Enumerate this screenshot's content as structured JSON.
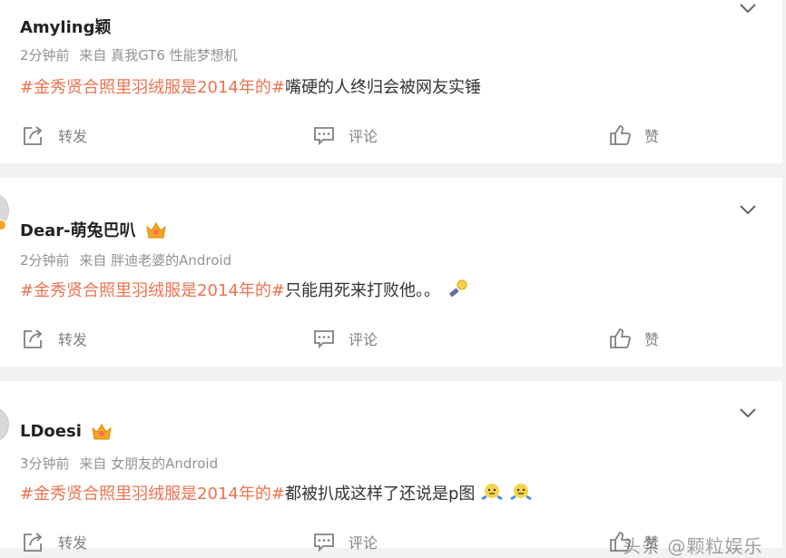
{
  "actions": {
    "repost": "转发",
    "comment": "评论",
    "like": "赞"
  },
  "posts": [
    {
      "name": "Amyling颖",
      "badge": "",
      "time": "2分钟前",
      "source": "来自 真我GT6 性能梦想机",
      "topic": "#金秀贤合照里羽绒服是2014年的#",
      "text": "嘴硬的人终归会被网友实锤",
      "emojis": []
    },
    {
      "name": "Dear-萌兔巴叭",
      "badge": "crown-icon",
      "time": "2分钟前",
      "source": "来自 胖迪老婆的Android",
      "topic": "#金秀贤合照里羽绒服是2014年的#",
      "text": "只能用死来打败他。。",
      "emojis": [
        "hammer-emoji"
      ]
    },
    {
      "name": "LDoesi",
      "badge": "crown-icon",
      "time": "3分钟前",
      "source": "来自 女朋友的Android",
      "topic": "#金秀贤合照里羽绒服是2014年的#",
      "text": "都被扒成这样了还说是p图",
      "emojis": [
        "shrug-emoji",
        "shrug-emoji"
      ]
    }
  ],
  "colors": {
    "topic": "#eb7350",
    "page_bg": "#f2f2f2",
    "card_bg": "#ffffff",
    "meta": "#939393"
  },
  "watermark": "头条 @颗粒娱乐"
}
